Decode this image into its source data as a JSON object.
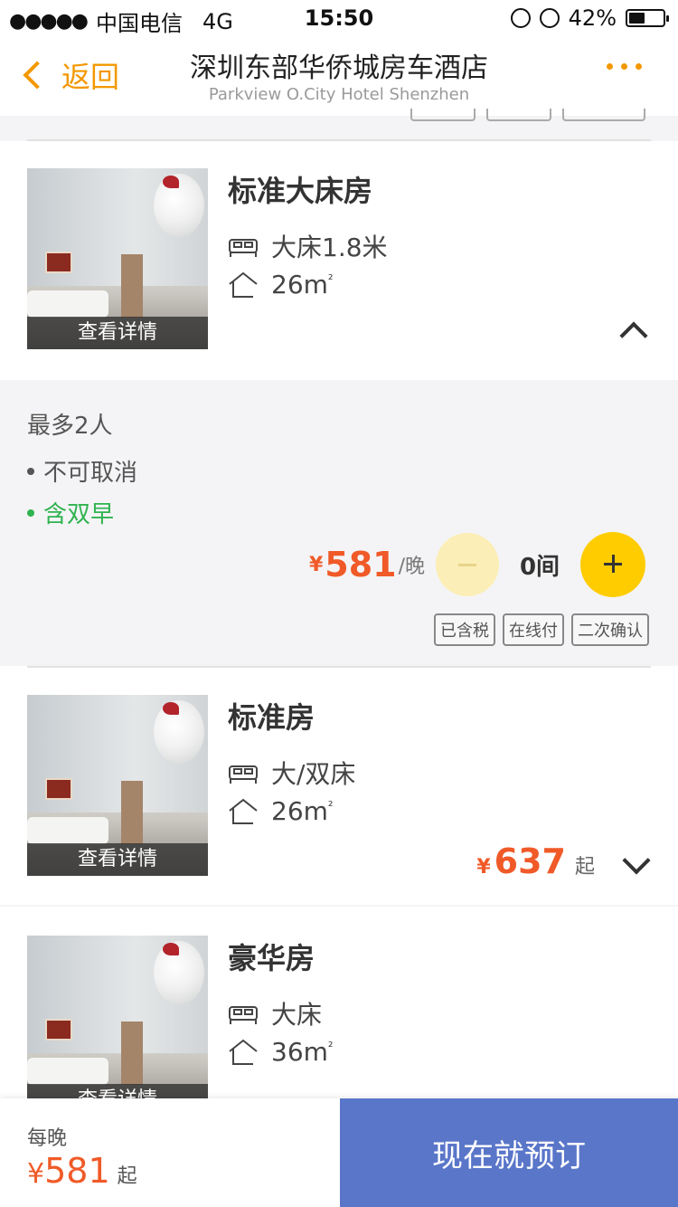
{
  "status_bar": {
    "carrier": "中国电信",
    "network": "4G",
    "time": "15:50",
    "battery": "42%"
  },
  "nav": {
    "back_label": "返回",
    "title": "深圳东部华侨城房车酒店",
    "subtitle": "Parkview O.City Hotel Shenzhen"
  },
  "rooms": [
    {
      "name": "标准大床房",
      "bed": "大床1.8米",
      "area": "26m",
      "area_unit": "²",
      "image_caption": "查看详情"
    },
    {
      "name": "标准房",
      "bed": "大/双床",
      "area": "26m",
      "area_unit": "²",
      "image_caption": "查看详情",
      "price_symbol": "¥",
      "price": "637",
      "price_suffix": "起"
    },
    {
      "name": "豪华房",
      "bed": "大床",
      "area": "36m",
      "area_unit": "²",
      "image_caption": "查看详情"
    }
  ],
  "rate_plan": {
    "occupancy": "最多2人",
    "cancel_policy": "不可取消",
    "breakfast": "含双早",
    "price_symbol": "¥",
    "price": "581",
    "price_unit": "/晚",
    "room_count": "0间",
    "tags": [
      "已含税",
      "在线付",
      "二次确认"
    ]
  },
  "bottom_bar": {
    "label": "每晚",
    "price_symbol": "¥",
    "price": "581",
    "price_suffix": "起",
    "book_button": "现在就预订"
  },
  "colors": {
    "accent": "#f39800",
    "price": "#f05a28",
    "plus_button": "#ffcc00",
    "book_button": "#5a76c9",
    "breakfast": "#2fb34f"
  }
}
